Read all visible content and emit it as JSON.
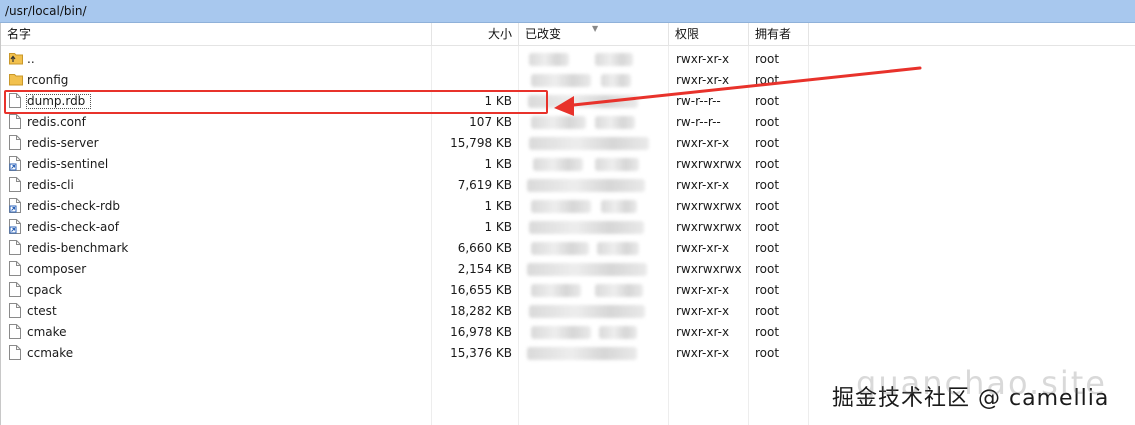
{
  "path": "/usr/local/bin/",
  "columns": {
    "name": "名字",
    "size": "大小",
    "modified": "已改变",
    "permissions": "权限",
    "owner": "拥有者"
  },
  "files": [
    {
      "name": "..",
      "size": "",
      "permissions": "rwxr-xr-x",
      "owner": "root",
      "icon": "parent-folder-icon"
    },
    {
      "name": "rconfig",
      "size": "",
      "permissions": "rwxr-xr-x",
      "owner": "root",
      "icon": "folder-icon"
    },
    {
      "name": "dump.rdb",
      "size": "1 KB",
      "permissions": "rw-r--r--",
      "owner": "root",
      "icon": "file-icon"
    },
    {
      "name": "redis.conf",
      "size": "107 KB",
      "permissions": "rw-r--r--",
      "owner": "root",
      "icon": "file-icon"
    },
    {
      "name": "redis-server",
      "size": "15,798 KB",
      "permissions": "rwxr-xr-x",
      "owner": "root",
      "icon": "file-icon"
    },
    {
      "name": "redis-sentinel",
      "size": "1 KB",
      "permissions": "rwxrwxrwx",
      "owner": "root",
      "icon": "symlink-icon"
    },
    {
      "name": "redis-cli",
      "size": "7,619 KB",
      "permissions": "rwxr-xr-x",
      "owner": "root",
      "icon": "file-icon"
    },
    {
      "name": "redis-check-rdb",
      "size": "1 KB",
      "permissions": "rwxrwxrwx",
      "owner": "root",
      "icon": "symlink-icon"
    },
    {
      "name": "redis-check-aof",
      "size": "1 KB",
      "permissions": "rwxrwxrwx",
      "owner": "root",
      "icon": "symlink-icon"
    },
    {
      "name": "redis-benchmark",
      "size": "6,660 KB",
      "permissions": "rwxr-xr-x",
      "owner": "root",
      "icon": "file-icon"
    },
    {
      "name": "composer",
      "size": "2,154 KB",
      "permissions": "rwxrwxrwx",
      "owner": "root",
      "icon": "file-icon"
    },
    {
      "name": "cpack",
      "size": "16,655 KB",
      "permissions": "rwxr-xr-x",
      "owner": "root",
      "icon": "file-icon"
    },
    {
      "name": "ctest",
      "size": "18,282 KB",
      "permissions": "rwxr-xr-x",
      "owner": "root",
      "icon": "file-icon"
    },
    {
      "name": "cmake",
      "size": "16,978 KB",
      "permissions": "rwxr-xr-x",
      "owner": "root",
      "icon": "file-icon"
    },
    {
      "name": "ccmake",
      "size": "15,376 KB",
      "permissions": "rwxr-xr-x",
      "owner": "root",
      "icon": "file-icon"
    }
  ],
  "highlight": {
    "row": "dump.rdb",
    "color": "#e8322b"
  },
  "watermark": {
    "main": "掘金技术社区 @ camellia",
    "ghost": "guanchao.site"
  },
  "colors": {
    "path_bar": "#a8c8ee",
    "folder": "#f2c14e",
    "annotation": "#e8322b"
  }
}
